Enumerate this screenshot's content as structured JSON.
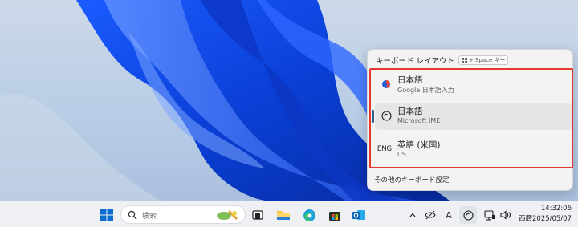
{
  "flyout": {
    "title": "キーボード レイアウト",
    "shortcut_key": "Space キー",
    "items": [
      {
        "name": "日本語",
        "sub": "Google 日本語入力",
        "icon": "google-ime-icon",
        "selected": false
      },
      {
        "name": "日本語",
        "sub": "Microsoft IME",
        "icon": "microsoft-ime-icon",
        "selected": true
      },
      {
        "name": "英語 (米国)",
        "sub": "US",
        "icon": "eng-label",
        "code": "ENG",
        "selected": false
      }
    ],
    "footer": "その他のキーボード設定"
  },
  "taskbar": {
    "search_placeholder": "検索",
    "tray": {
      "ime_indicator": "A"
    },
    "clock": {
      "time": "14:32:06",
      "date": "西暦2025/05/07"
    }
  },
  "colors": {
    "highlight_box": "#e33a2e",
    "selection_bar": "#2d5d8c"
  }
}
